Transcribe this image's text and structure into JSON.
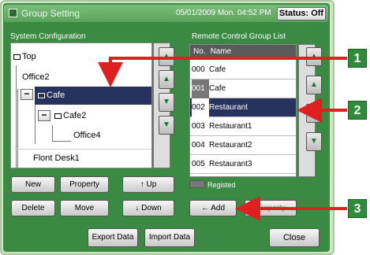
{
  "window": {
    "title": "Group Setting",
    "datetime": "05/01/2009 Mon. 04:52 PM",
    "status": "Status: Off"
  },
  "system_config": {
    "heading": "System Configuration",
    "nodes": [
      "Top",
      "Office2",
      "Cafe",
      "Cafe2",
      "Office4",
      "Flont Desk1"
    ],
    "selected": "Cafe"
  },
  "tree_buttons": {
    "new": "New",
    "property": "Property",
    "up": "Up",
    "delete": "Delete",
    "move": "Move",
    "down": "Down"
  },
  "remote_group": {
    "heading": "Remote Control Group List",
    "columns": [
      "No.",
      "Name"
    ],
    "rows": [
      {
        "no": "000",
        "name": "Cafe"
      },
      {
        "no": "001",
        "name": "Cafe"
      },
      {
        "no": "002",
        "name": "Restaurant"
      },
      {
        "no": "003",
        "name": "Restaurant1"
      },
      {
        "no": "004",
        "name": "Restaurant2"
      },
      {
        "no": "005",
        "name": "Restaurant3"
      }
    ],
    "selected_no": "002",
    "legend": "Registed"
  },
  "list_buttons": {
    "add": "Add",
    "property": "Property"
  },
  "footer": {
    "export": "Export Data",
    "import": "Import Data",
    "close": "Close"
  },
  "callouts": [
    "1",
    "2",
    "3"
  ],
  "colors": {
    "callout": "#2f8c3a",
    "arrow": "#e02020",
    "selection": "#27325f"
  }
}
